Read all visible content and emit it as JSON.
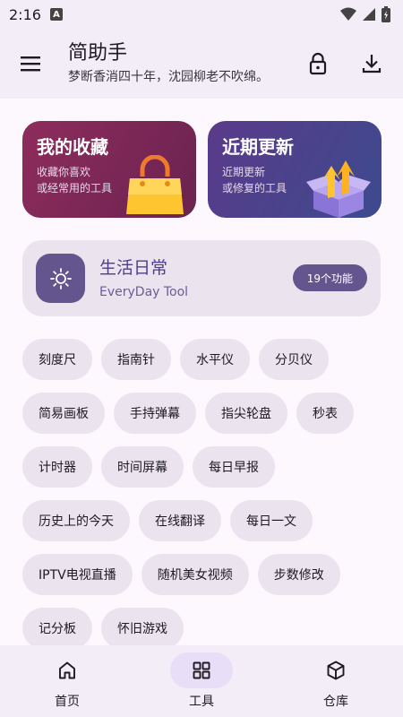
{
  "status": {
    "time": "2:16",
    "badge": "A"
  },
  "header": {
    "title": "简助手",
    "subtitle": "梦断香消四十年，沈园柳老不吹绵。",
    "icons": [
      "menu-icon",
      "lock-icon",
      "download-icon"
    ]
  },
  "cards": [
    {
      "title": "我的收藏",
      "desc": "收藏你喜欢\n或经常用的工具",
      "icon": "shopping-bag-icon"
    },
    {
      "title": "近期更新",
      "desc": "近期更新\n或修复的工具",
      "icon": "box-arrows-icon"
    }
  ],
  "category": {
    "title": "生活日常",
    "subtitle": "EveryDay Tool",
    "badge": "19个功能",
    "icon": "sun-icon"
  },
  "tools": [
    "刻度尺",
    "指南针",
    "水平仪",
    "分贝仪",
    "简易画板",
    "手持弹幕",
    "指尖轮盘",
    "秒表",
    "计时器",
    "时间屏幕",
    "每日早报",
    "历史上的今天",
    "在线翻译",
    "每日一文",
    "IPTV电视直播",
    "随机美女视频",
    "步数修改",
    "记分板",
    "怀旧游戏"
  ],
  "nav": [
    {
      "label": "首页",
      "icon": "home-icon",
      "active": false
    },
    {
      "label": "工具",
      "icon": "grid-icon",
      "active": true
    },
    {
      "label": "仓库",
      "icon": "cube-icon",
      "active": false
    }
  ],
  "colors": {
    "accent": "#65558f",
    "chip": "#ebe3ee",
    "background": "#fdf7fe"
  }
}
